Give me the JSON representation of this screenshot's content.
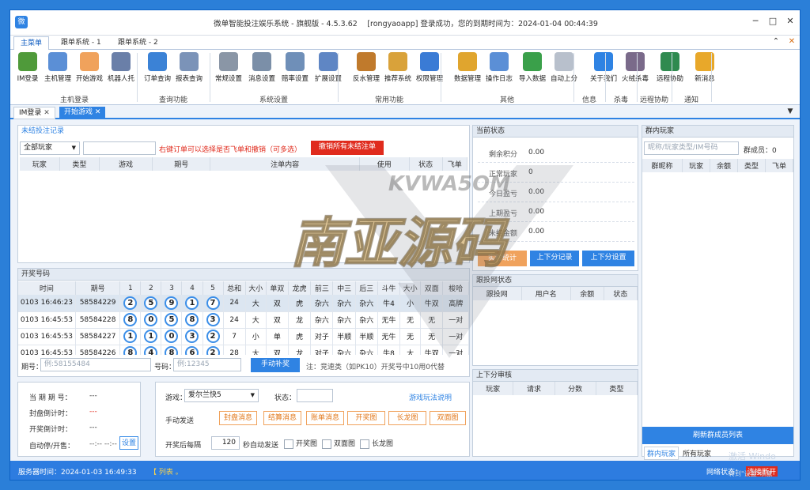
{
  "window": {
    "title": "微单智能投注娱乐系统 - 旗舰版 - 4.5.3.62　 [rongyaoapp] 登录成功，您的到期时间为：2024-01-04 00:44:39"
  },
  "menu_tabs": [
    "主菜单",
    "跟单系统 - 1",
    "跟单系统 - 2"
  ],
  "ribbon": {
    "tools": [
      {
        "label": "IM登录",
        "icon": "im-login-icon"
      },
      {
        "label": "主机管理",
        "icon": "host-manage-icon"
      },
      {
        "label": "开始游戏",
        "icon": "start-game-icon"
      },
      {
        "label": "机器人托",
        "icon": "robot-icon"
      },
      {
        "label": "订单查询",
        "icon": "order-search-icon"
      },
      {
        "label": "报表查询",
        "icon": "report-icon"
      },
      {
        "label": "常规设置",
        "icon": "gear-icon"
      },
      {
        "label": "消息设置",
        "icon": "message-settings-icon"
      },
      {
        "label": "赔率设置",
        "icon": "odds-settings-icon"
      },
      {
        "label": "扩展设置",
        "icon": "extension-settings-icon"
      },
      {
        "label": "反水管理",
        "icon": "rebate-icon"
      },
      {
        "label": "推荐系统",
        "icon": "referral-icon"
      },
      {
        "label": "权限管理",
        "icon": "permission-icon"
      },
      {
        "label": "数据管理",
        "icon": "database-icon"
      },
      {
        "label": "操作日志",
        "icon": "log-icon"
      },
      {
        "label": "导入数据",
        "icon": "import-icon"
      },
      {
        "label": "自动上分",
        "icon": "auto-topup-icon"
      },
      {
        "label": "关于我们",
        "icon": "info-icon"
      },
      {
        "label": "火绒杀毒",
        "icon": "antivirus-icon"
      },
      {
        "label": "远程协助",
        "icon": "remote-assist-icon"
      },
      {
        "label": "新消息",
        "icon": "bell-icon"
      }
    ],
    "groups": [
      "主机登录",
      "查询功能",
      "系统设置",
      "常用功能",
      "其他",
      "信息",
      "杀毒",
      "远程协助",
      "通知"
    ]
  },
  "doc_tabs": [
    "IM登录",
    "开始游戏"
  ],
  "unsettled": {
    "title": "未结投注记录",
    "filter": "全部玩家",
    "hint": "右键订单可以选择是否飞单和撤销（可多选）",
    "cancel_all": "撤销所有未结注单",
    "columns": [
      "玩家",
      "类型",
      "游戏",
      "期号",
      "注单内容",
      "使用",
      "状态",
      "飞单"
    ]
  },
  "lottery": {
    "title": "开奖号码",
    "columns": [
      "时间",
      "期号",
      "1",
      "2",
      "3",
      "4",
      "5",
      "总和",
      "大小",
      "单双",
      "龙虎",
      "前三",
      "中三",
      "后三",
      "斗牛",
      "大小",
      "双面",
      "梭哈"
    ],
    "rows": [
      {
        "time": "0103 16:46:23",
        "issue": "58584229",
        "balls": [
          "2",
          "5",
          "9",
          "1",
          "7"
        ],
        "sum": "24",
        "bs": "大",
        "oe": "双",
        "lh": "虎",
        "q3": "杂六",
        "z3": "杂六",
        "h3": "杂六",
        "dn": "牛4",
        "bs2": "小",
        "sm": "牛双",
        "sh": "高牌"
      },
      {
        "time": "0103 16:45:53",
        "issue": "58584228",
        "balls": [
          "8",
          "0",
          "5",
          "8",
          "3"
        ],
        "sum": "24",
        "bs": "大",
        "oe": "双",
        "lh": "龙",
        "q3": "杂六",
        "z3": "杂六",
        "h3": "杂六",
        "dn": "无牛",
        "bs2": "无",
        "sm": "无",
        "sh": "一对"
      },
      {
        "time": "0103 16:45:53",
        "issue": "58584227",
        "balls": [
          "1",
          "1",
          "0",
          "3",
          "2"
        ],
        "sum": "7",
        "bs": "小",
        "oe": "单",
        "lh": "虎",
        "q3": "对子",
        "z3": "半顺",
        "h3": "半顺",
        "dn": "无牛",
        "bs2": "无",
        "sm": "无",
        "sh": "一对"
      },
      {
        "time": "0103 16:45:53",
        "issue": "58584226",
        "balls": [
          "8",
          "4",
          "8",
          "6",
          "2"
        ],
        "sum": "28",
        "bs": "大",
        "oe": "双",
        "lh": "龙",
        "q3": "对子",
        "z3": "杂六",
        "h3": "杂六",
        "dn": "牛8",
        "bs2": "大",
        "sm": "牛双",
        "sh": "一对"
      }
    ]
  },
  "supplement": {
    "issue_label": "期号：",
    "issue_ph": "例:58155484",
    "code_label": "号码：",
    "code_ph": "例:12345",
    "button": "手动补奖",
    "note": "注：竞速类（如PK10）开奖号中10用0代替"
  },
  "current": {
    "issue_label": "当 期 期 号：",
    "issue_val": "---",
    "seal_label": "封盘倒计时：",
    "seal_val": "---",
    "open_label": "开奖倒计时：",
    "open_val": "---",
    "auto_label": "自动停/开售：",
    "auto_val": "--:-- --:--",
    "setup": "设置"
  },
  "game": {
    "label": "游戏：",
    "value": "爱尔兰快5",
    "status_label": "状态：",
    "help": "游戏玩法说明",
    "manual_label": "手动发送",
    "buttons": [
      "封盘消息",
      "结算消息",
      "账单消息",
      "开奖图",
      "长龙图",
      "双面图"
    ],
    "interval_label": "开奖后每隔",
    "interval": "120",
    "interval_suffix": "秒自动发送",
    "checks": [
      "开奖图",
      "双面图",
      "长龙图"
    ]
  },
  "status": {
    "title": "当前状态",
    "rows": [
      {
        "k": "剩余积分",
        "v": "0.00"
      },
      {
        "k": "正常玩家",
        "v": "0"
      },
      {
        "k": "今日盈亏",
        "v": "0.00"
      },
      {
        "k": "上期盈亏",
        "v": "0.00"
      },
      {
        "k": "未结金额",
        "v": "0.00"
      }
    ],
    "btn_live": "实时统计",
    "btn_record": "上下分记录",
    "btn_setting": "上下分设置"
  },
  "follow": {
    "title": "跟投网状态",
    "columns": [
      "跟投网",
      "用户名",
      "余额",
      "状态"
    ]
  },
  "audit": {
    "title": "上下分审核",
    "columns": [
      "玩家",
      "请求",
      "分数",
      "类型"
    ]
  },
  "group": {
    "title": "群内玩家",
    "search_ph": "昵称/玩家类型/IM号码",
    "count_label": "群成员：0",
    "columns": [
      "群昵称",
      "玩家",
      "余额",
      "类型",
      "飞单"
    ],
    "refresh": "刷新群成员列表",
    "tabs": [
      "群内玩家",
      "所有玩家"
    ]
  },
  "statusbar": {
    "server_time": "服务器时间：2024-01-03 16:49:33",
    "list": "【 列表 。",
    "net_label": "网络状态：",
    "net_value": "连接断开",
    "activate1": "激活 Windo",
    "activate2": "转到\"设置\"以激"
  },
  "watermark": {
    "top": "KVWA5OM",
    "main": "南亚源码"
  },
  "colors": {
    "accent": "#2f83e3",
    "danger": "#e02b1d",
    "orange": "#f0a25c"
  }
}
